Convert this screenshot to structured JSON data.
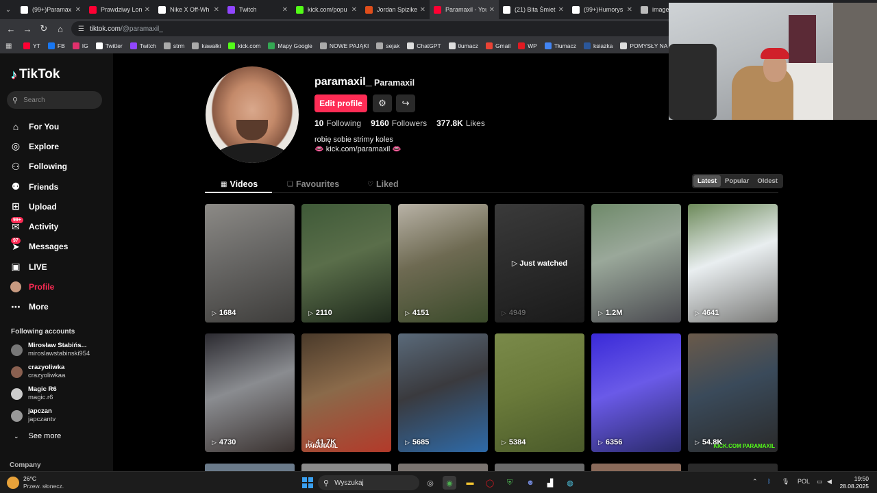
{
  "browser": {
    "tabs": [
      {
        "label": "(99+)Paramax",
        "color": "#ffffff"
      },
      {
        "label": "Prawdziwy Lon",
        "color": "#ff0033"
      },
      {
        "label": "Nike X Off-Wh",
        "color": "#ffffff"
      },
      {
        "label": "Twitch",
        "color": "#9146ff"
      },
      {
        "label": "kick.com/popu",
        "color": "#53fc18"
      },
      {
        "label": "Jordan Spizike",
        "color": "#e04e1b"
      },
      {
        "label": "Paramaxil - You",
        "color": "#ff0033"
      },
      {
        "label": "(21) Bita Śmiet",
        "color": "#ffffff"
      },
      {
        "label": "(99+)Humorys",
        "color": "#ffffff"
      },
      {
        "label": "image",
        "color": "#bbbbbb"
      }
    ],
    "url_host": "tiktok.com",
    "url_path": "/@paramaxil_",
    "bookmarks": [
      {
        "label": "YT",
        "color": "#ff0033"
      },
      {
        "label": "FB",
        "color": "#1877f2"
      },
      {
        "label": "IG",
        "color": "#e1306c"
      },
      {
        "label": "Twitter",
        "color": "#ffffff"
      },
      {
        "label": "Twitch",
        "color": "#9146ff"
      },
      {
        "label": "strm",
        "color": "#aaaaaa"
      },
      {
        "label": "kawałki",
        "color": "#aaaaaa"
      },
      {
        "label": "kick.com",
        "color": "#53fc18"
      },
      {
        "label": "Mapy Google",
        "color": "#34a853"
      },
      {
        "label": "NOWE PAJĄKI",
        "color": "#aaaaaa"
      },
      {
        "label": "sejak",
        "color": "#aaaaaa"
      },
      {
        "label": "ChatGPT",
        "color": "#dddddd"
      },
      {
        "label": "tłumacz",
        "color": "#dddddd"
      },
      {
        "label": "Gmail",
        "color": "#ea4335"
      },
      {
        "label": "WP",
        "color": "#e01a22"
      },
      {
        "label": "Tłumacz",
        "color": "#4285f4"
      },
      {
        "label": "ksiazka",
        "color": "#2b579a"
      },
      {
        "label": "POMYSŁY NA STRE...",
        "color": "#dddddd"
      }
    ]
  },
  "sidebar": {
    "logo": "TikTok",
    "search_placeholder": "Search",
    "nav": [
      {
        "label": "For You",
        "icon": "home-icon",
        "glyph": "⌂"
      },
      {
        "label": "Explore",
        "icon": "compass-icon",
        "glyph": "◎"
      },
      {
        "label": "Following",
        "icon": "person-follow-icon",
        "glyph": "⚇"
      },
      {
        "label": "Friends",
        "icon": "friends-icon",
        "glyph": "⚉"
      },
      {
        "label": "Upload",
        "icon": "plus-square-icon",
        "glyph": "⊞"
      },
      {
        "label": "Activity",
        "icon": "activity-icon",
        "glyph": "✉",
        "badge": "99+"
      },
      {
        "label": "Messages",
        "icon": "paper-plane-icon",
        "glyph": "➤",
        "badge": "97"
      },
      {
        "label": "LIVE",
        "icon": "live-icon",
        "glyph": "▣"
      },
      {
        "label": "Profile",
        "icon": "profile-icon",
        "glyph": "●",
        "active": true
      },
      {
        "label": "More",
        "icon": "more-icon",
        "glyph": "⋯"
      }
    ],
    "following_header": "Following accounts",
    "accounts": [
      {
        "name": "Mirosław Stabińs...",
        "handle": "miroslawstabinski954",
        "color": "#777777"
      },
      {
        "name": "crazyoliwka",
        "handle": "crazyoliwkaa",
        "color": "#8a6050"
      },
      {
        "name": "Magic R6",
        "handle": "magic.r6",
        "color": "#cccccc"
      },
      {
        "name": "japczan",
        "handle": "japczantv",
        "color": "#999999"
      }
    ],
    "see_more": "See more",
    "company": "Company"
  },
  "profile": {
    "username": "paramaxil_",
    "nickname": "Paramaxil",
    "edit_label": "Edit profile",
    "following_count": "10",
    "following_label": "Following",
    "followers_count": "9160",
    "followers_label": "Followers",
    "likes_count": "377.8K",
    "likes_label": "Likes",
    "bio_line1": "robię sobie strimy koles",
    "bio_line2": "👄 kick.com/paramaxil 👄",
    "tabs": [
      "Videos",
      "Favourites",
      "Liked"
    ],
    "sort": [
      "Latest",
      "Popular",
      "Oldest"
    ]
  },
  "videos": [
    {
      "views": "1684",
      "bg": "linear-gradient(160deg,#8c8a86 0%,#6b6a68 40%,#3e3d3b 100%)"
    },
    {
      "views": "2110",
      "bg": "linear-gradient(160deg,#3f5a38 0%,#5a6e4a 45%,#1f2a1c 100%)"
    },
    {
      "views": "4151",
      "bg": "linear-gradient(160deg,#b8b2a6 0%,#6e6a52 45%,#3a4a2a 100%)"
    },
    {
      "views": "4949",
      "bg": "linear-gradient(160deg,#3a3a3a 0%,#2a2a2a 50%,#1a1a1a 100%)",
      "dim": true,
      "note": "Just watched"
    },
    {
      "views": "1.2M",
      "bg": "linear-gradient(160deg,#6f8a6a 0%,#9aa89a 40%,#4a4a50 100%)"
    },
    {
      "views": "4641",
      "bg": "linear-gradient(160deg,#6d8a5a 0%,#e9eef0 45%,#7a7a78 100%)"
    },
    {
      "views": "4730",
      "bg": "linear-gradient(160deg,#2b2a30 0%,#8a8c90 45%,#3a3230 100%)"
    },
    {
      "views": "41.7K",
      "bg": "linear-gradient(160deg,#4a3a2a 0%,#8a6a4a 45%,#b33a2a 100%)"
    },
    {
      "views": "5685",
      "bg": "linear-gradient(160deg,#5a6a7a 0%,#3a3a3e 45%,#2e6aa8 100%)"
    },
    {
      "views": "5384",
      "bg": "linear-gradient(160deg,#7a8a4a 0%,#6a7a3a 45%,#4a5a2a 100%)"
    },
    {
      "views": "6356",
      "bg": "linear-gradient(160deg,#3a2ad8 0%,#6a5ae8 45%,#2a2a6a 100%)"
    },
    {
      "views": "54.8K",
      "bg": "linear-gradient(160deg,#6a5a4a 0%,#3a4a5a 45%,#2a2a2a 100%)"
    }
  ],
  "overlay_watermarks": {
    "v8": "PARAMAXIL",
    "v12": "KICK.COM PARAMAXIL"
  },
  "taskbar": {
    "temperature": "26°C",
    "weather": "Przew. słonecz.",
    "search_label": "Wyszukaj",
    "lang": "POL",
    "time": "19:50",
    "date": "28.08.2025"
  }
}
